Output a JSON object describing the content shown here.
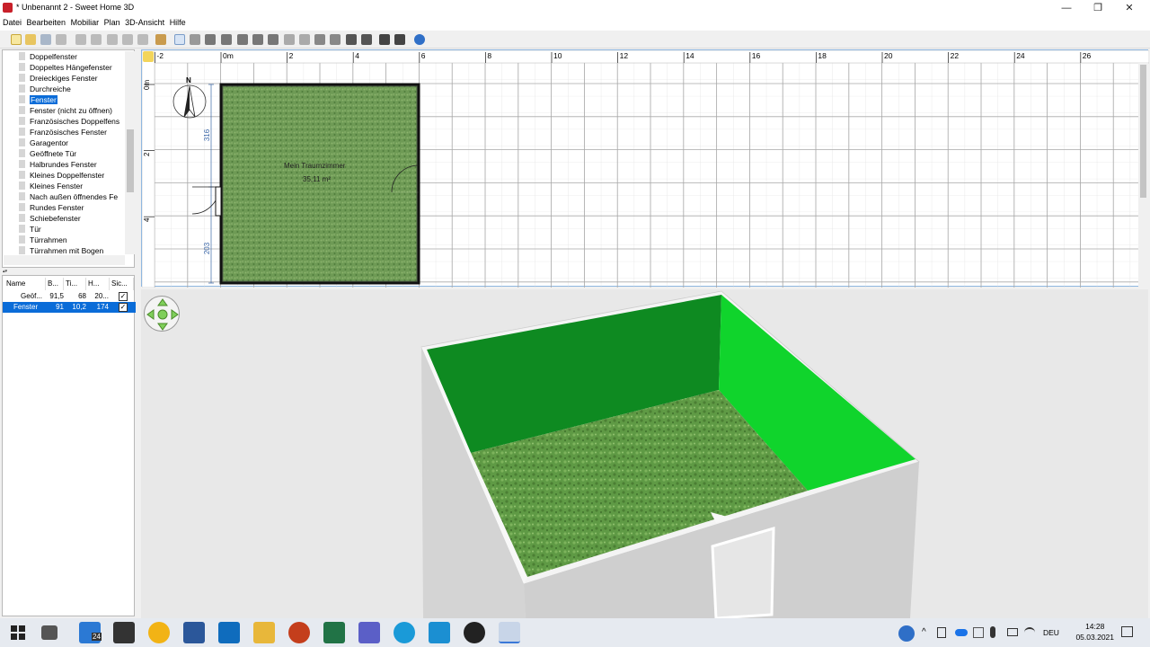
{
  "window": {
    "title": "* Unbenannt 2 - Sweet Home 3D",
    "minimize": "—",
    "maximize": "❐",
    "close": "✕"
  },
  "menu": [
    "Datei",
    "Bearbeiten",
    "Mobiliar",
    "Plan",
    "3D-Ansicht",
    "Hilfe"
  ],
  "catalog": {
    "items": [
      "Doppelfenster",
      "Doppeltes Hängefenster",
      "Dreieckiges Fenster",
      "Durchreiche",
      "Fenster",
      "Fenster (nicht zu öffnen)",
      "Französisches Doppelfens",
      "Französisches Fenster",
      "Garagentor",
      "Geöffnete Tür",
      "Halbrundes Fenster",
      "Kleines Doppelfenster",
      "Kleines Fenster",
      "Nach außen öffnendes Fe",
      "Rundes Fenster",
      "Schiebefenster",
      "Tür",
      "Türrahmen",
      "Türrahmen mit Bogen"
    ],
    "selected_index": 4
  },
  "furniture": {
    "columns": [
      "Name",
      "B...",
      "Ti...",
      "H...",
      "Sic..."
    ],
    "rows": [
      {
        "name": "Geöf...",
        "w": "91,5",
        "d": "68",
        "h": "20...",
        "visible": "✓"
      },
      {
        "name": "Fenster",
        "w": "91",
        "d": "10,2",
        "h": "174",
        "visible": "✓"
      }
    ]
  },
  "plan": {
    "ruler_x": [
      "-2",
      "0m",
      "2",
      "4",
      "6",
      "8",
      "10",
      "12",
      "14",
      "16",
      "18",
      "20",
      "22",
      "24",
      "26"
    ],
    "ruler_y": [
      "0m",
      "2",
      "4"
    ],
    "room_name": "Mein Traumzimmer",
    "room_area": "35,11 m²",
    "dim_top": "316",
    "dim_bottom": "203",
    "compass": "N"
  },
  "taskbar": {
    "weather": "24",
    "lang": "DEU",
    "time": "14:28",
    "date": "05.03.2021"
  },
  "colors": {
    "wall_green_dark": "#0e8a21",
    "wall_green_light": "#10d42c",
    "floor": "#5f9a45",
    "selection": "#0a6cd8"
  }
}
